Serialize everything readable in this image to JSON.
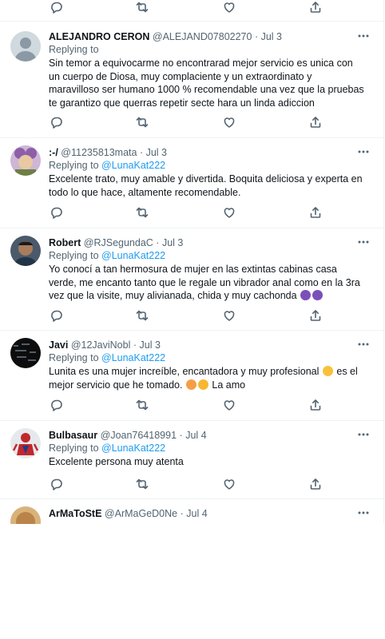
{
  "icons": {
    "reply": "reply-icon",
    "retweet": "retweet-icon",
    "like": "like-icon",
    "share": "share-icon",
    "more": "more-icon"
  },
  "colors": {
    "link": "#1d9bf0",
    "secondary_text": "#536471",
    "primary_text": "#0f1419",
    "divider": "#eff3f4"
  },
  "tweets": [
    {
      "name": "ALEJANDRO CERON",
      "handle": "@ALEJAND07802270",
      "separator": "·",
      "date": "Jul 3",
      "reply_prefix": "Replying to ",
      "reply_to": "",
      "text": "Sin temor a equivocarme no encontrarad mejor servicio es unica con un cuerpo de Diosa, muy complaciente y un extraordinato y maravilloso ser humano 1000 % recomendable una vez que la pruebas te garantizo que querras repetir secte hara un linda adiccion"
    },
    {
      "name": ":-/",
      "handle": "@11235813mata",
      "separator": "·",
      "date": "Jul 3",
      "reply_prefix": "Replying to ",
      "reply_to": "@LunaKat222",
      "text": "Excelente trato, muy amable y divertida. Boquita deliciosa y experta en todo lo que hace, altamente recomendable."
    },
    {
      "name": "Robert",
      "handle": "@RJSegundaC",
      "separator": "·",
      "date": "Jul 3",
      "reply_prefix": "Replying to ",
      "reply_to": "@LunaKat222",
      "text": "Yo conocí a tan hermosura de mujer en las extintas cabinas casa verde, me encanto tanto que le regale un vibrador anal como en la 3ra vez que la visite, muy alivianada, chida y muy cachonda"
    },
    {
      "name": "Javi",
      "handle": "@12JaviNobl",
      "separator": "·",
      "date": "Jul 3",
      "reply_prefix": "Replying to ",
      "reply_to": "@LunaKat222",
      "text_1": "Lunita es una mujer increíble, encantadora y muy profesional",
      "text_2": "es el mejor servicio que he tomado.",
      "text_3": "La amo"
    },
    {
      "name": "Bulbasaur",
      "handle": "@Joan76418991",
      "separator": "·",
      "date": "Jul 4",
      "reply_prefix": "Replying to ",
      "reply_to": "@LunaKat222",
      "text": "Excelente persona muy atenta"
    },
    {
      "name": "ArMaToStE",
      "handle": "@ArMaGeD0Ne",
      "separator": "·",
      "date": "Jul 4"
    }
  ]
}
